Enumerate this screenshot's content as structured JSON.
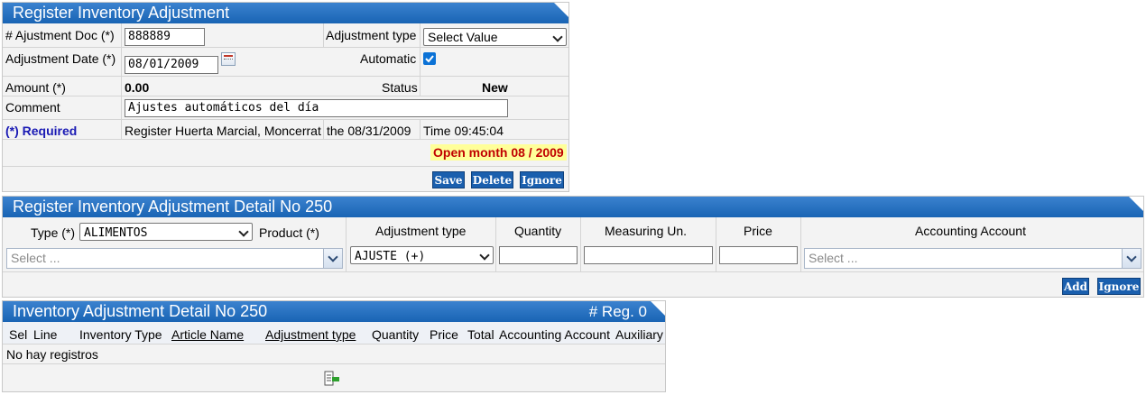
{
  "register": {
    "title": "Register Inventory Adjustment",
    "doc_label": "# Ajustment Doc (*)",
    "doc_value": "888889",
    "adj_type_label": "Adjustment type",
    "adj_type_value": "Select Value",
    "date_label": "Adjustment Date (*)",
    "date_value": "08/01/2009",
    "automatic_label": "Automatic",
    "automatic_checked": true,
    "amount_label": "Amount (*)",
    "amount_value": "0.00",
    "status_label": "Status",
    "status_value": "New",
    "comment_label": "Comment",
    "comment_value": "Ajustes automáticos del día",
    "required_note": "(*) Required",
    "register_by": "Register Huerta Marcial, Moncerrat",
    "register_date": "the 08/31/2009",
    "register_time": "Time 09:45:04",
    "open_month": "Open month 08 / 2009",
    "save_label": "Save",
    "delete_label": "Delete",
    "ignore_label": "Ignore"
  },
  "detail_form": {
    "title": "Register Inventory Adjustment Detail No 250",
    "type_label": "Type (*)",
    "type_value": "ALIMENTOS",
    "product_label": "Product (*)",
    "product_placeholder": "Select ...",
    "adj_type_header": "Adjustment type",
    "adj_type_value": "AJUSTE (+)",
    "quantity_header": "Quantity",
    "measuring_header": "Measuring Un.",
    "price_header": "Price",
    "account_header": "Accounting Account",
    "account_placeholder": "Select ...",
    "add_label": "Add",
    "ignore_label": "Ignore"
  },
  "detail_list": {
    "title": "Inventory Adjustment Detail No 250",
    "reg_count": "# Reg. 0",
    "columns": [
      "Sel",
      "Line",
      "Inventory Type",
      "Article Name",
      "Adjustment type",
      "Quantity",
      "Price",
      "Total",
      "Accounting Account",
      "Auxiliary"
    ],
    "empty_message": "No hay registros"
  },
  "colors": {
    "title_bar": "#1964b4",
    "button": "#1a5fae",
    "required": "#1a1ab4",
    "open_month_bg": "#ffff99",
    "open_month_text": "#c00000"
  },
  "icons": [
    "calendar-icon",
    "checkbox-icon",
    "chevron-down-icon",
    "export-icon"
  ]
}
